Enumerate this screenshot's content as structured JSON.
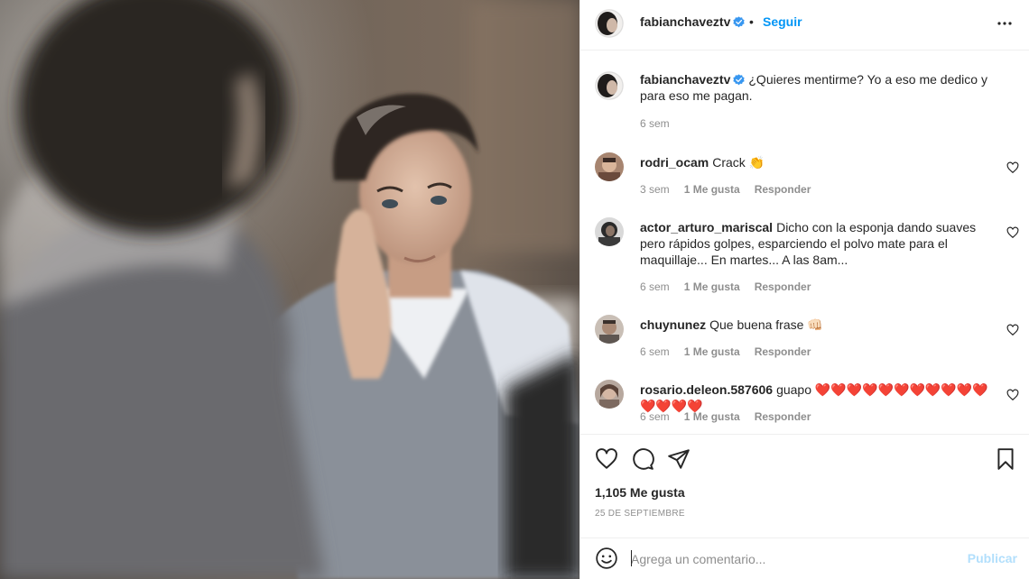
{
  "header": {
    "username": "fabianchaveztv",
    "separator": "•",
    "follow_label": "Seguir",
    "more_icon": "more-horizontal-icon"
  },
  "caption": {
    "username": "fabianchaveztv",
    "text": "¿Quieres mentirme? Yo a eso me dedico y para eso me pagan.",
    "time": "6 sem"
  },
  "comments": [
    {
      "username": "rodri_ocam",
      "text": "Crack 👏",
      "time": "3 sem",
      "likes": "1 Me gusta",
      "reply": "Responder"
    },
    {
      "username": "actor_arturo_mariscal",
      "text": "Dicho con la esponja dando suaves pero rápidos golpes, esparciendo el polvo mate para el maquillaje... En martes... A las 8am...",
      "time": "6 sem",
      "likes": "1 Me gusta",
      "reply": "Responder"
    },
    {
      "username": "chuynunez",
      "text": "Que buena frase 👊🏻",
      "time": "6 sem",
      "likes": "1 Me gusta",
      "reply": "Responder"
    },
    {
      "username": "rosario.deleon.587606",
      "text": "guapo ❤️❤️❤️❤️❤️❤️❤️❤️❤️❤️❤️❤️❤️❤️❤️",
      "time": "6 sem",
      "likes": "1 Me gusta",
      "reply": "Responder"
    }
  ],
  "actions": {
    "like_icon": "heart-icon",
    "comment_icon": "comment-icon",
    "share_icon": "paper-plane-icon",
    "save_icon": "bookmark-icon",
    "likes_count": "1,105 Me gusta",
    "date": "25 DE SEPTIEMBRE"
  },
  "add_comment": {
    "emoji_icon": "emoji-icon",
    "placeholder": "Agrega un comentario...",
    "publish_label": "Publicar"
  },
  "colors": {
    "accent": "#0095f6",
    "verified": "#3897f0",
    "publish_disabled": "#b2dffc",
    "muted": "#8e8e8e"
  }
}
